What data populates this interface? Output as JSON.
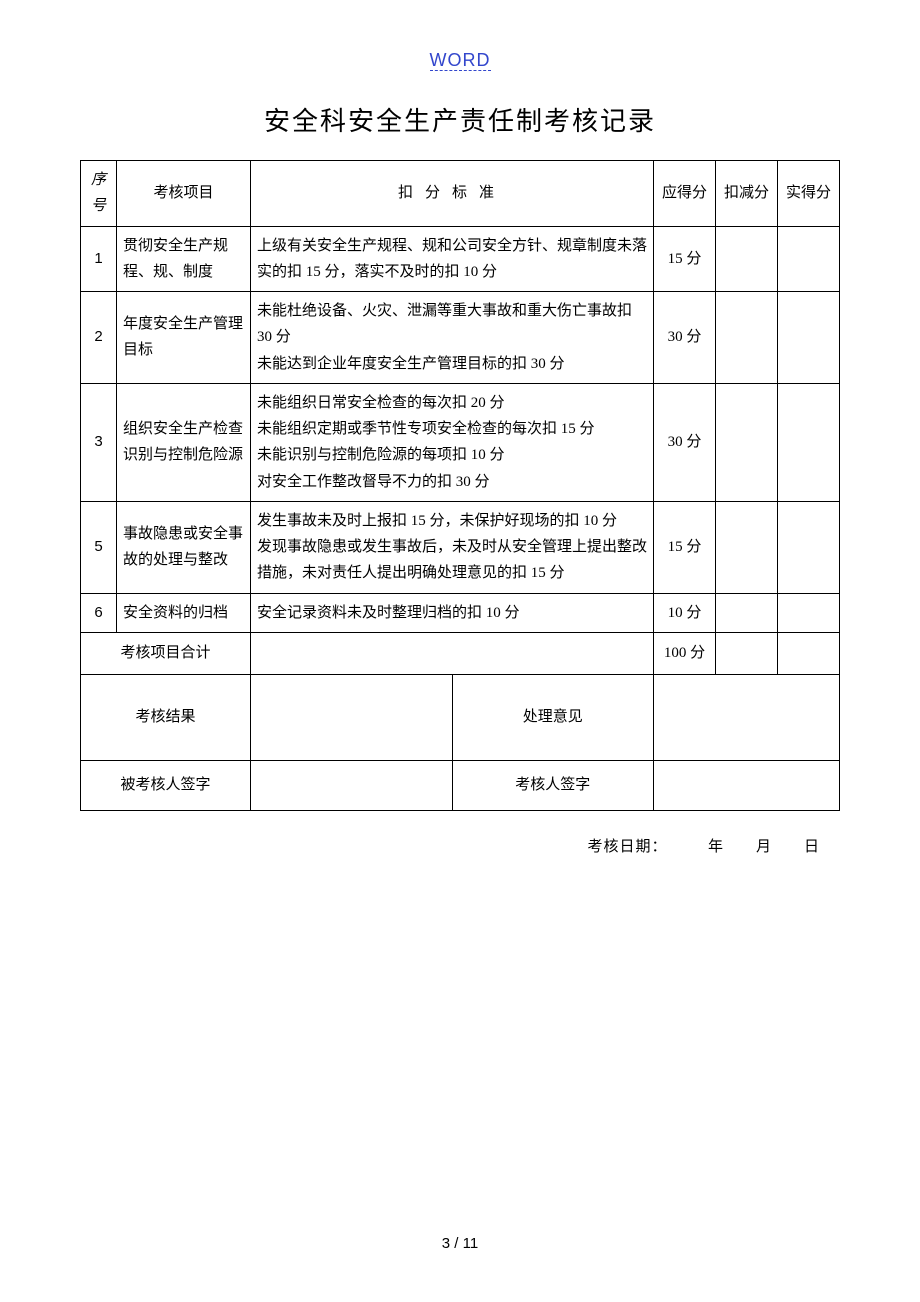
{
  "header": {
    "link_text": "WORD"
  },
  "title": "安全科安全生产责任制考核记录",
  "columns": {
    "num": "序号",
    "item": "考核项目",
    "criteria": "扣分标准",
    "score": "应得分",
    "deduct": "扣减分",
    "actual": "实得分"
  },
  "rows": [
    {
      "num": "1",
      "item": "贯彻安全生产规程、规、制度",
      "criteria": "上级有关安全生产规程、规和公司安全方针、规章制度未落实的扣 15 分，落实不及时的扣 10 分",
      "score": "15 分"
    },
    {
      "num": "2",
      "item": "年度安全生产管理目标",
      "criteria": "未能杜绝设备、火灾、泄漏等重大事故和重大伤亡事故扣 30 分\n未能达到企业年度安全生产管理目标的扣 30 分",
      "score": "30 分"
    },
    {
      "num": "3",
      "item": "组织安全生产检查识别与控制危险源",
      "criteria": "未能组织日常安全检查的每次扣 20 分\n未能组织定期或季节性专项安全检查的每次扣 15 分\n未能识别与控制危险源的每项扣 10 分\n对安全工作整改督导不力的扣 30 分",
      "score": "30 分"
    },
    {
      "num": "5",
      "item": "事故隐患或安全事故的处理与整改",
      "criteria": "发生事故未及时上报扣 15 分，未保护好现场的扣 10 分\n发现事故隐患或发生事故后，未及时从安全管理上提出整改措施，未对责任人提出明确处理意见的扣 15 分",
      "score": "15 分"
    },
    {
      "num": "6",
      "item": "安全资料的归档",
      "criteria": "安全记录资料未及时整理归档的扣 10 分",
      "score": "10 分"
    }
  ],
  "total": {
    "label": "考核项目合计",
    "score": "100 分"
  },
  "result": {
    "label": "考核结果",
    "opinion": "处理意见"
  },
  "sign": {
    "examinee": "被考核人签字",
    "examiner": "考核人签字"
  },
  "footer_date": "考核日期：　　　年　　月　　日",
  "page_number": "3 / 11"
}
